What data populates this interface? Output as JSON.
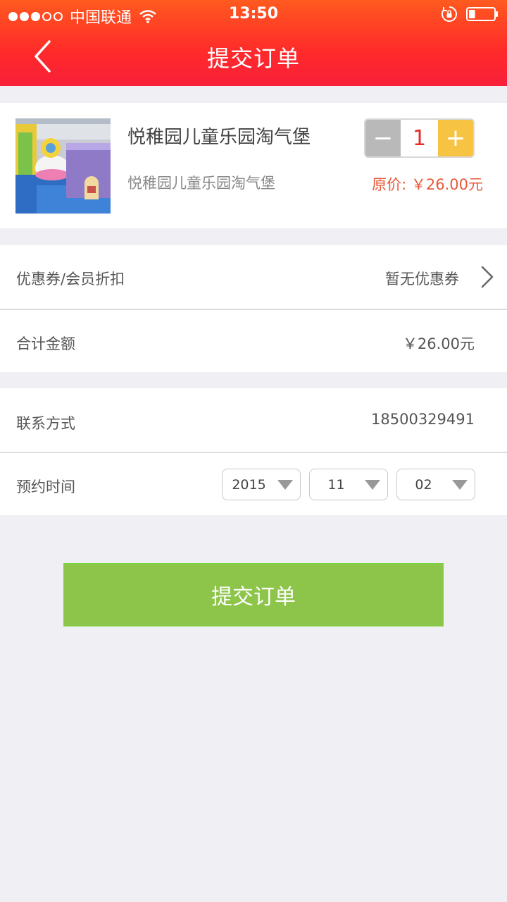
{
  "status_bar": {
    "carrier": "中国联通",
    "time": "13:50",
    "signal_icon": "signal-dots-icon",
    "wifi_icon": "wifi-icon",
    "rotation_lock_icon": "rotation-lock-icon",
    "battery_icon": "battery-icon",
    "battery_level": 0.25
  },
  "nav": {
    "title": "提交订单",
    "back_icon": "chevron-left-icon"
  },
  "colors": {
    "header_top": "#ff5a1f",
    "header_bottom": "#f81f3a",
    "accent_red": "#e52b2b",
    "price_text": "#e85a3a",
    "plus_button": "#f6c342",
    "minus_button": "#b9b9b9",
    "submit_button": "#8dc54a",
    "page_background": "#efeff4"
  },
  "product": {
    "name": "悦稚园儿童乐园淘气堡",
    "subtitle": "悦稚园儿童乐园淘气堡",
    "quantity": "1",
    "minus_label": "−",
    "plus_label": "+",
    "price_label": "原价:",
    "price_value": "￥26.00元"
  },
  "coupon": {
    "label": "优惠券/会员折扣",
    "value": "暂无优惠券"
  },
  "total": {
    "label": "合计金额",
    "value": "￥26.00元"
  },
  "contact": {
    "label": "联系方式",
    "value": "18500329491"
  },
  "booking": {
    "label": "预约时间",
    "year": "2015",
    "month": "11",
    "day": "02"
  },
  "submit": {
    "label": "提交订单"
  }
}
